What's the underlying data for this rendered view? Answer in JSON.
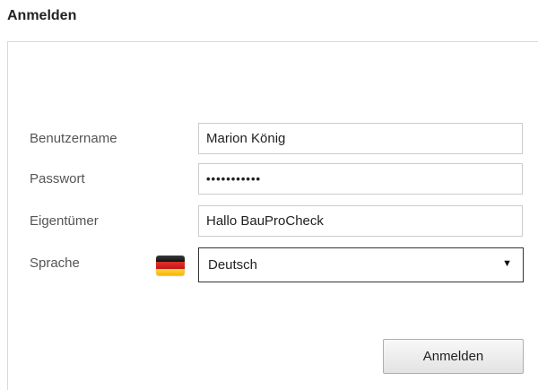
{
  "header": {
    "title": "Anmelden"
  },
  "form": {
    "username": {
      "label": "Benutzername",
      "value": "Marion König"
    },
    "password": {
      "label": "Passwort",
      "value": "•••••••••••"
    },
    "owner": {
      "label": "Eigentümer",
      "value": "Hallo BauProCheck"
    },
    "language": {
      "label": "Sprache",
      "value": "Deutsch",
      "flag": "german-flag-icon",
      "arrow": "▼"
    },
    "submit_label": "Anmelden"
  }
}
